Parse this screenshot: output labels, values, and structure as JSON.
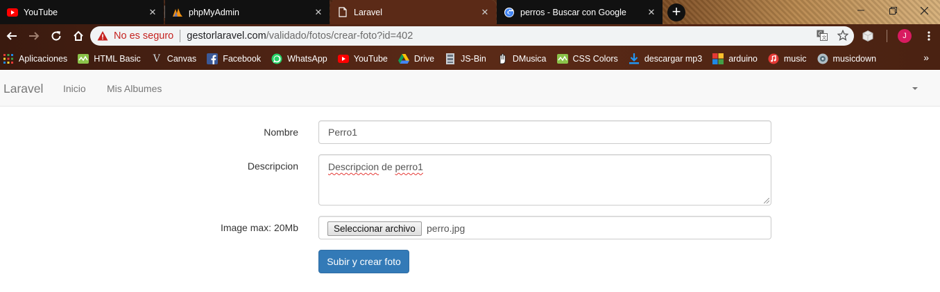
{
  "browser": {
    "tabs": [
      {
        "title": "YouTube",
        "icon": "youtube-icon"
      },
      {
        "title": "phpMyAdmin",
        "icon": "phpmyadmin-icon"
      },
      {
        "title": "Laravel",
        "icon": "document-icon",
        "active": true
      },
      {
        "title": "perros - Buscar con Google",
        "icon": "google-icon"
      }
    ],
    "close_glyph": "✕",
    "new_tab_glyph": "+",
    "address": {
      "security_label": "No es seguro",
      "host": "gestorlaravel.com",
      "path": "/validado/fotos/crear-foto?id=402"
    },
    "profile_initial": "J",
    "bookmarks": [
      {
        "label": "Aplicaciones",
        "icon": "apps-grid-icon"
      },
      {
        "label": "HTML Basic",
        "icon": "html-basic-icon"
      },
      {
        "label": "Canvas",
        "icon": "canvas-icon"
      },
      {
        "label": "Facebook",
        "icon": "facebook-icon"
      },
      {
        "label": "WhatsApp",
        "icon": "whatsapp-icon"
      },
      {
        "label": "YouTube",
        "icon": "youtube-icon"
      },
      {
        "label": "Drive",
        "icon": "drive-icon"
      },
      {
        "label": "JS-Bin",
        "icon": "jsbin-icon"
      },
      {
        "label": "DMusica",
        "icon": "dmusica-icon"
      },
      {
        "label": "CSS Colors",
        "icon": "css-colors-icon"
      },
      {
        "label": "descargar mp3",
        "icon": "download-icon"
      },
      {
        "label": "arduino",
        "icon": "arduino-icon"
      },
      {
        "label": "music",
        "icon": "music-icon"
      },
      {
        "label": "musicdown",
        "icon": "musicdown-icon"
      }
    ],
    "bookmarks_overflow": "»"
  },
  "app": {
    "brand": "Laravel",
    "nav": [
      "Inicio",
      "Mis Albumes"
    ]
  },
  "form": {
    "nombre_label": "Nombre",
    "nombre_value": "Perro1",
    "descripcion_label": "Descripcion",
    "descripcion_word1": "Descripcion",
    "descripcion_word2": "de",
    "descripcion_word3": "perro1",
    "image_label": "Image max: 20Mb",
    "file_button": "Seleccionar archivo",
    "file_name": "perro.jpg",
    "submit": "Subir y crear foto"
  },
  "colors": {
    "primary_button": "#337ab7",
    "insecure_red": "#c5221f",
    "navbar_bg": "#f8f8f8"
  }
}
